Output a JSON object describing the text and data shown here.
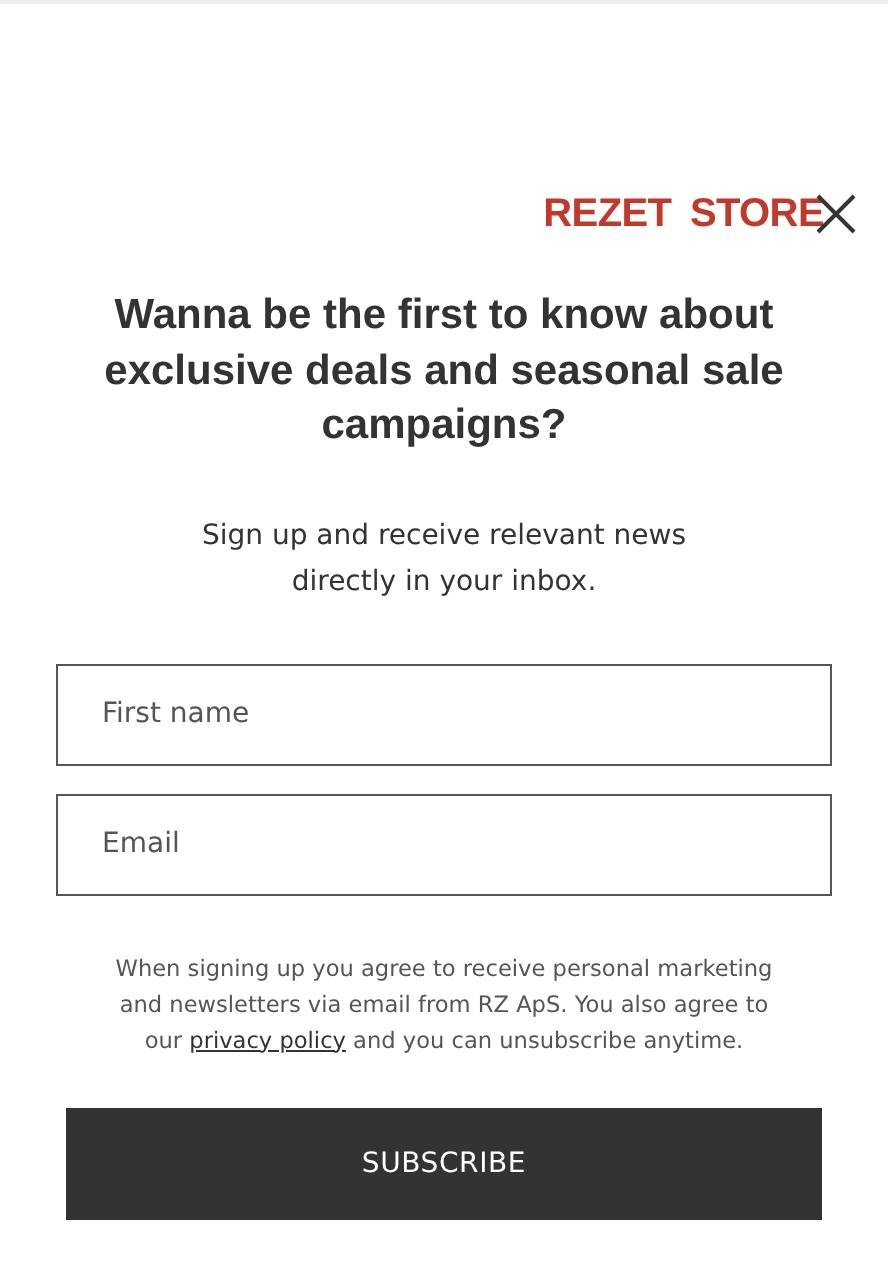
{
  "logo": {
    "text": "REZET STORE"
  },
  "heading": "Wanna be the first to know about exclusive deals and seasonal sale campaigns?",
  "subtitle": "Sign up and receive relevant news directly in your inbox.",
  "fields": [
    {
      "placeholder": "First name"
    },
    {
      "placeholder": "Email"
    }
  ],
  "consent": {
    "before": "When signing up you agree to receive personal marketing and newsletters via email from RZ ApS. You also agree to our",
    "link": "privacy policy",
    "after": "and you can unsubscribe anytime."
  },
  "button": "SUBSCRIBE"
}
